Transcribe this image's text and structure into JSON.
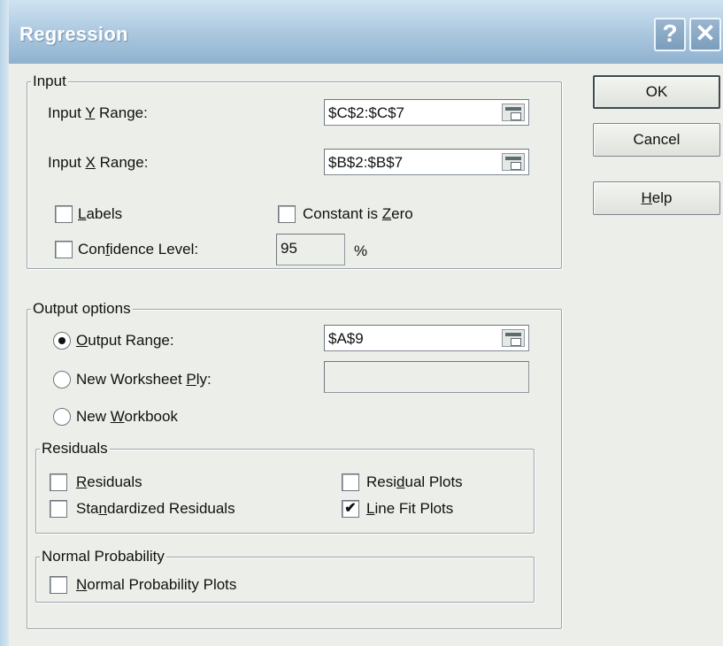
{
  "window": {
    "title": "Regression",
    "help_glyph": "?",
    "close_glyph": "✕"
  },
  "input": {
    "legend": "Input",
    "y_range_label": "Input Y Range:",
    "y_range_value": "$C$2:$C$7",
    "x_range_label": "Input X Range:",
    "x_range_value": "$B$2:$B$7",
    "labels_label": "Labels",
    "labels_checked": false,
    "constant_zero_label": "Constant is Zero",
    "constant_zero_checked": false,
    "confidence_label": "Confidence Level:",
    "confidence_checked": false,
    "confidence_value": "95",
    "confidence_unit": "%"
  },
  "output": {
    "legend": "Output options",
    "output_range_label": "Output Range:",
    "output_range_value": "$A$9",
    "output_range_selected": true,
    "new_ply_label": "New Worksheet Ply:",
    "new_ply_value": "",
    "new_workbook_label": "New Workbook"
  },
  "residuals": {
    "legend": "Residuals",
    "residuals_label": "Residuals",
    "residuals_checked": false,
    "standardized_label": "Standardized Residuals",
    "standardized_checked": false,
    "residual_plots_label": "Residual Plots",
    "residual_plots_checked": false,
    "line_fit_label": "Line Fit Plots",
    "line_fit_checked": true
  },
  "normal_probability": {
    "legend": "Normal Probability",
    "plots_label": "Normal Probability Plots",
    "plots_checked": false
  },
  "buttons": {
    "ok": "OK",
    "cancel": "Cancel",
    "help": "Help"
  },
  "check_glyph": "✔"
}
